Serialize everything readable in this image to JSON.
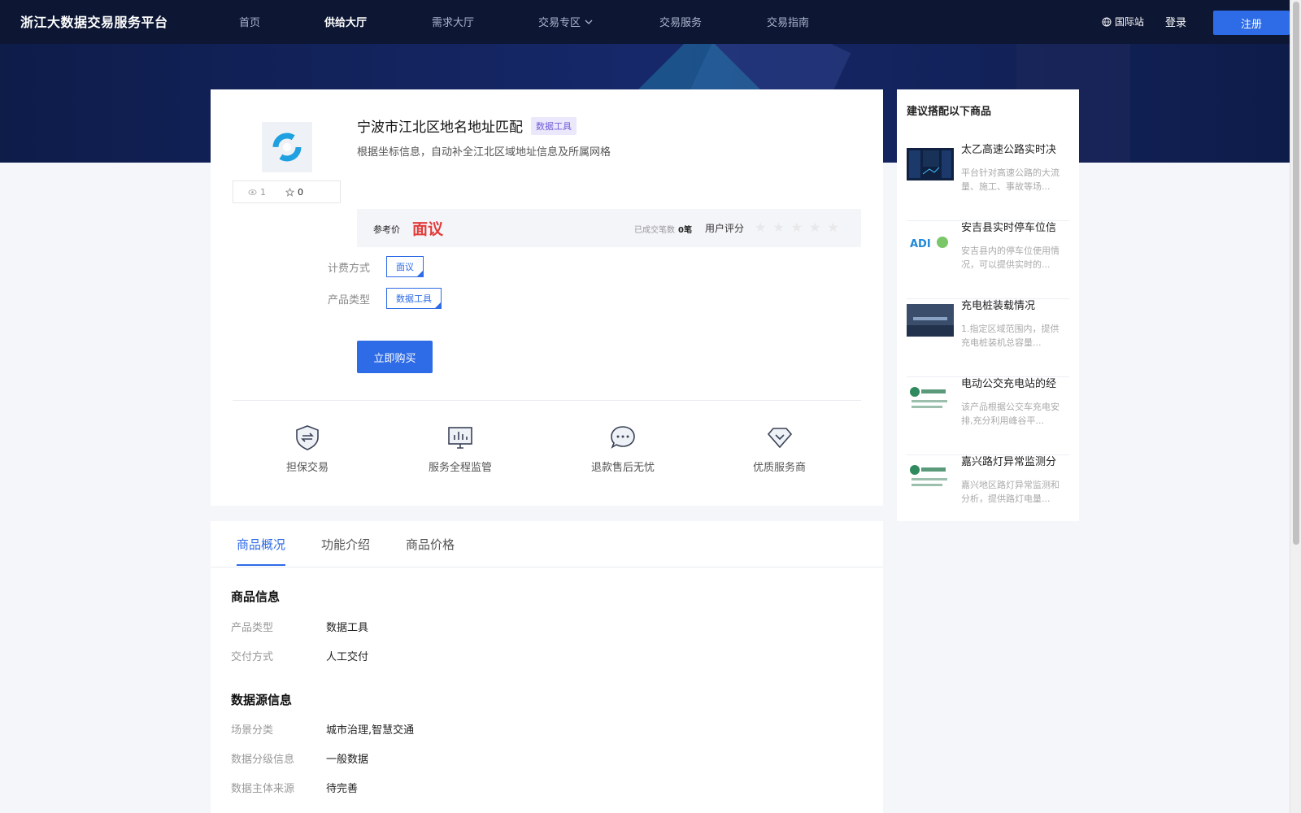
{
  "nav": {
    "brand": "浙江大数据交易服务平台",
    "links": [
      "首页",
      "供给大厅",
      "需求大厅",
      "交易专区",
      "交易服务",
      "交易指南"
    ],
    "intl": "国际站",
    "login": "登录",
    "register": "注册"
  },
  "product": {
    "title": "宁波市江北区地名地址匹配",
    "tag": "数据工具",
    "desc": "根据坐标信息，自动补全江北区域地址信息及所属网格",
    "views": "1",
    "favorites": "0",
    "price_label": "参考价",
    "price_value": "面议",
    "trade_label": "已成交笔数",
    "trade_count": "0笔",
    "rating_label": "用户评分",
    "rating": 0,
    "rating_max": 5,
    "billing_label": "计费方式",
    "billing_value": "面议",
    "type_label": "产品类型",
    "type_value": "数据工具",
    "buy": "立即购买"
  },
  "features": [
    "担保交易",
    "服务全程监管",
    "退款售后无忧",
    "优质服务商"
  ],
  "sidebar": {
    "title": "建议搭配以下商品",
    "items": [
      {
        "name": "太乙高速公路实时决",
        "desc": "平台针对高速公路的大流量、施工、事故等场..."
      },
      {
        "name": "安吉县实时停车位信",
        "desc": "安吉县内的停车位使用情况，可以提供实时的..."
      },
      {
        "name": "充电桩装载情况",
        "desc": "1.指定区域范围内，提供充电桩装机总容量..."
      },
      {
        "name": "电动公交充电站的经",
        "desc": "该产品根据公交车充电安排,充分利用峰谷平..."
      },
      {
        "name": "嘉兴路灯异常监测分",
        "desc": "嘉兴地区路灯异常监测和分析，提供路灯电量..."
      }
    ]
  },
  "tabs": [
    "商品概况",
    "功能介绍",
    "商品价格"
  ],
  "details": {
    "section1": "商品信息",
    "rows1": [
      {
        "k": "产品类型",
        "v": "数据工具"
      },
      {
        "k": "交付方式",
        "v": "人工交付"
      }
    ],
    "section2": "数据源信息",
    "rows2": [
      {
        "k": "场景分类",
        "v": "城市治理,智慧交通"
      },
      {
        "k": "数据分级信息",
        "v": "一般数据"
      },
      {
        "k": "数据主体来源",
        "v": "待完善"
      }
    ]
  },
  "colors": {
    "accent": "#2e6be6",
    "price": "#e23b3b",
    "nav_bg": "#0d1734"
  }
}
